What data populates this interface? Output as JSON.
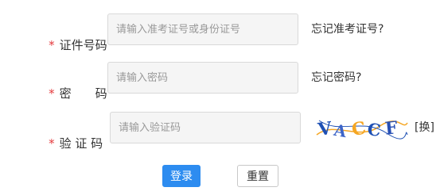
{
  "form": {
    "required_mark": "*",
    "id_field": {
      "label": "证件号码",
      "placeholder": "请输入准考证号或身份证号",
      "forgot_link": "忘记准考证号?"
    },
    "password_field": {
      "label": "密　　码",
      "placeholder": "请输入密码",
      "forgot_link": "忘记密码?"
    },
    "captcha_field": {
      "label": "验 证 码",
      "placeholder": "请输入验证码",
      "captcha_text": "VACCF",
      "refresh_link": "[换]"
    },
    "buttons": {
      "login": "登录",
      "reset": "重置"
    }
  },
  "colors": {
    "required": "#e4393c",
    "primary": "#2d8cf0",
    "input_bg": "#f5f5f5",
    "captcha_ink": "#1e50b4",
    "captcha_accent": "#f5a623"
  }
}
